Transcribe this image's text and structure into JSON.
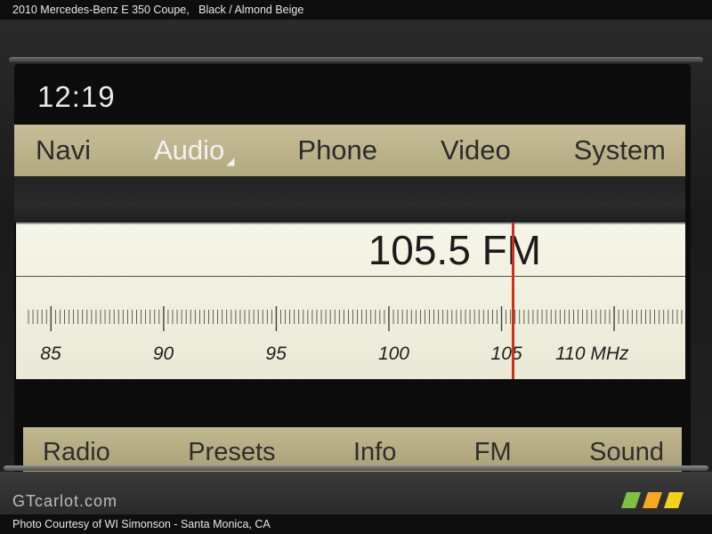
{
  "top_caption": {
    "title": "2010 Mercedes-Benz E 350 Coupe,",
    "color": "Black / Almond Beige"
  },
  "display": {
    "clock": "12:19",
    "menu": [
      {
        "label": "Navi",
        "active": false
      },
      {
        "label": "Audio",
        "active": true
      },
      {
        "label": "Phone",
        "active": false
      },
      {
        "label": "Video",
        "active": false
      },
      {
        "label": "System",
        "active": false
      }
    ],
    "tuner": {
      "frequency": "105.5 FM",
      "current_mhz": 105.5,
      "scale_range_mhz": [
        84,
        113
      ],
      "scale_labels": [
        "85",
        "90",
        "95",
        "100",
        "105",
        "110 MHz"
      ],
      "scale_values": [
        85,
        90,
        95,
        100,
        105,
        110
      ]
    },
    "softkeys": [
      "Radio",
      "Presets",
      "Info",
      "FM",
      "Sound"
    ]
  },
  "watermark": "GTcarlot.com",
  "bottom_caption": "Photo Courtesy of WI Simonson - Santa Monica, CA",
  "colors": {
    "menu_bar": "#c7bd98",
    "tuner_background": "#f6f6e8",
    "needle": "#c9331d",
    "active_menu_text": "#f2f2f2"
  }
}
